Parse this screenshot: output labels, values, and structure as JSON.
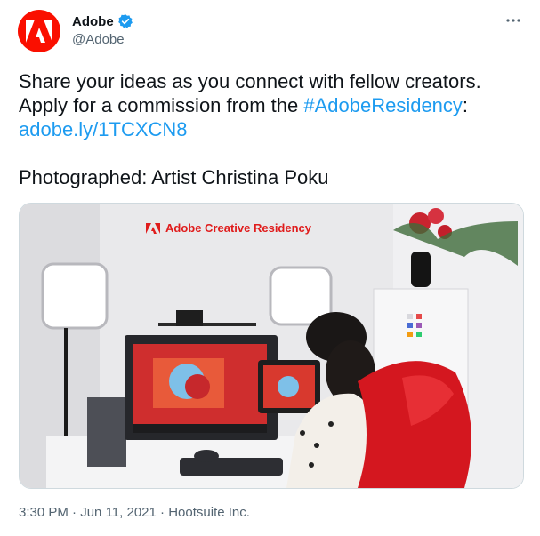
{
  "author": {
    "display_name": "Adobe",
    "handle": "@Adobe",
    "verified": true,
    "avatar_color": "#fa0f00"
  },
  "tweet": {
    "line1": "Share your ideas as you connect with fellow creators.",
    "line2_prefix": "Apply for a commission from the ",
    "hashtag": "#AdobeResidency",
    "line2_suffix": ":",
    "link": "adobe.ly/1TCXCN8",
    "caption": "Photographed: Artist Christina Poku"
  },
  "media": {
    "banner_text": "Adobe Creative Residency"
  },
  "footer": {
    "time": "3:30 PM",
    "sep1": " · ",
    "date": "Jun 11, 2021",
    "sep2": " · ",
    "source": "Hootsuite Inc."
  },
  "colors": {
    "link": "#1d9bf0",
    "verified": "#1d9bf0",
    "text": "#0f1419",
    "secondary": "#536471"
  },
  "icons": {
    "avatar_logo": "adobe-logo-icon",
    "verified": "verified-badge-icon",
    "more": "more-options-icon"
  }
}
